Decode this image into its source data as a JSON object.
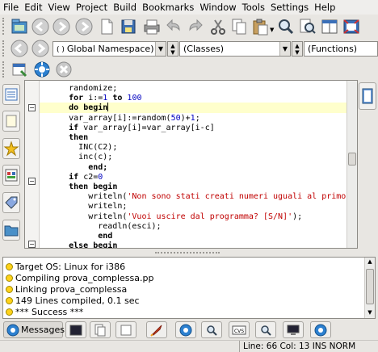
{
  "menubar": {
    "items": [
      "File",
      "Edit",
      "View",
      "Project",
      "Build",
      "Bookmarks",
      "Window",
      "Tools",
      "Settings",
      "Help"
    ]
  },
  "toolbar_main": {
    "buttons": [
      "new-project-icon",
      "back-icon",
      "forward-icon",
      "new-file-icon",
      "save-icon",
      "edit-icon",
      "print-icon",
      "undo-icon",
      "redo-icon",
      "cut-icon",
      "copy-icon",
      "paste-icon",
      "find-icon",
      "replace-icon",
      "window-icon"
    ]
  },
  "toolbar_nav": {
    "namespace_combo": "Global Namespace)",
    "classes_combo": "(Classes)",
    "functions_combo": "(Functions)"
  },
  "toolbar_build": {
    "buttons": [
      "build-icon",
      "run-icon",
      "stop-icon"
    ]
  },
  "editor": {
    "lines": [
      {
        "indent": "      ",
        "parts": [
          [
            "randomize;",
            ""
          ]
        ]
      },
      {
        "indent": "      ",
        "parts": [
          [
            "for",
            "kw"
          ],
          [
            " i:=",
            ""
          ],
          [
            "1",
            "num"
          ],
          [
            " ",
            ""
          ],
          [
            "to",
            "kw"
          ],
          [
            " ",
            ""
          ],
          [
            "100",
            "num"
          ]
        ]
      },
      {
        "indent": "      ",
        "parts": [
          [
            "do",
            "kw"
          ],
          [
            " ",
            ""
          ],
          [
            "begin",
            "kw"
          ]
        ],
        "current": true
      },
      {
        "indent": "      ",
        "parts": [
          [
            "var_array[i]:=random(",
            ""
          ],
          [
            "50",
            "num"
          ],
          [
            ")+",
            ""
          ],
          [
            "1",
            "num"
          ],
          [
            ";",
            ""
          ]
        ]
      },
      {
        "indent": "      ",
        "parts": [
          [
            "if",
            "kw"
          ],
          [
            " var_array[i]=var_array[i-c]",
            ""
          ]
        ]
      },
      {
        "indent": "      ",
        "parts": [
          [
            "then",
            "kw"
          ]
        ]
      },
      {
        "indent": "        ",
        "parts": [
          [
            "INC(C2);",
            ""
          ]
        ]
      },
      {
        "indent": "        ",
        "parts": [
          [
            "inc(c);",
            ""
          ]
        ]
      },
      {
        "indent": "          ",
        "parts": [
          [
            "end;",
            "kw"
          ]
        ]
      },
      {
        "indent": "      ",
        "parts": [
          [
            "if",
            "kw"
          ],
          [
            " c2=",
            ""
          ],
          [
            "0",
            "num"
          ]
        ]
      },
      {
        "indent": "      ",
        "parts": [
          [
            "then",
            "kw"
          ],
          [
            " ",
            ""
          ],
          [
            "begin",
            "kw"
          ]
        ]
      },
      {
        "indent": "          ",
        "parts": [
          [
            "writeln(",
            ""
          ],
          [
            "'Non sono stati creati numeri uguali al primo'",
            "str"
          ],
          [
            ");",
            ""
          ]
        ]
      },
      {
        "indent": "          ",
        "parts": [
          [
            "writeln;",
            ""
          ]
        ]
      },
      {
        "indent": "          ",
        "parts": [
          [
            "writeln(",
            ""
          ],
          [
            "'Vuoi uscire dal programma? [S/N]'",
            "str"
          ],
          [
            ");",
            ""
          ]
        ]
      },
      {
        "indent": "            ",
        "parts": [
          [
            "readln(esci);",
            ""
          ]
        ]
      },
      {
        "indent": "            ",
        "parts": [
          [
            "end",
            "kw"
          ]
        ]
      },
      {
        "indent": "      ",
        "parts": [
          [
            "else",
            "kw"
          ],
          [
            " ",
            ""
          ],
          [
            "begin",
            "kw"
          ]
        ]
      }
    ]
  },
  "messages": {
    "lines": [
      "Target OS: Linux for i386",
      "Compiling prova_complessa.pp",
      "Linking prova_complessa",
      "149 Lines compiled, 0.1 sec",
      "*** Success ***"
    ]
  },
  "bottom_tabs": {
    "messages_label": "Messages"
  },
  "status": {
    "text": "Line: 66 Col: 13  INS  NORM"
  },
  "colors": {
    "keyword": "#000000",
    "number": "#0000c0",
    "string": "#c00000",
    "current_line": "#ffffcc",
    "message_dot": "#ffd21a"
  }
}
